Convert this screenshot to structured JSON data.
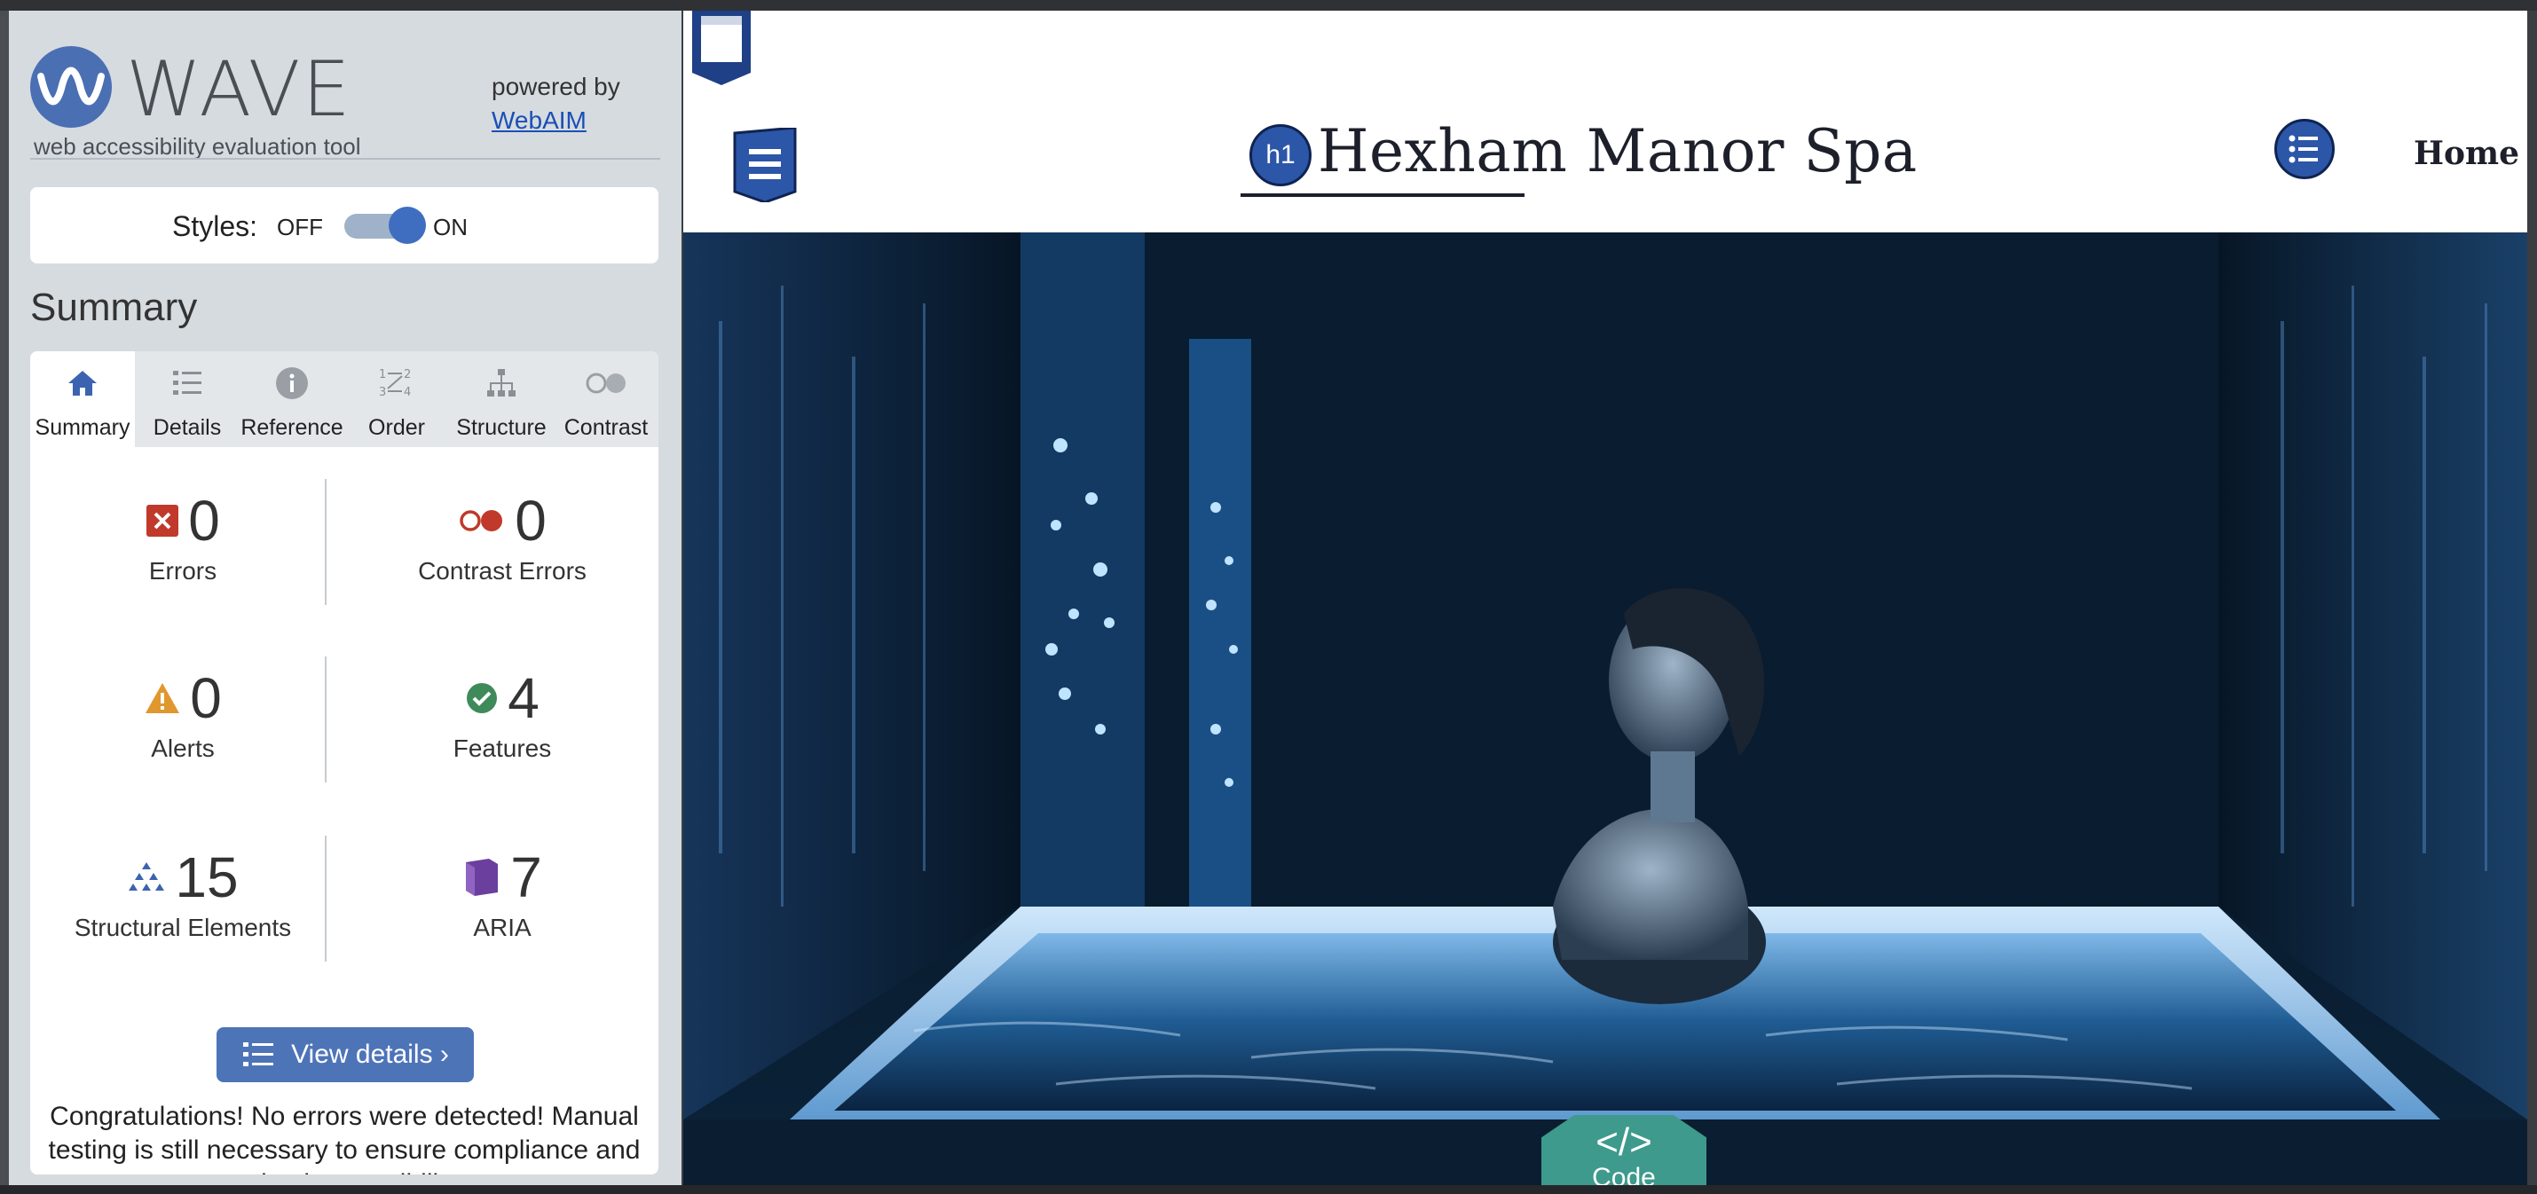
{
  "wave": {
    "brand": "WAVE",
    "tagline": "web accessibility evaluation tool",
    "powered_by": "powered by",
    "powered_link": "WebAIM",
    "styles_label": "Styles:",
    "off_label": "OFF",
    "on_label": "ON",
    "styles_on": true,
    "summary_title": "Summary",
    "tabs": [
      {
        "label": "Summary",
        "icon": "home-icon",
        "active": true
      },
      {
        "label": "Details",
        "icon": "list-icon",
        "active": false
      },
      {
        "label": "Reference",
        "icon": "info-icon",
        "active": false
      },
      {
        "label": "Order",
        "icon": "order-icon",
        "active": false
      },
      {
        "label": "Structure",
        "icon": "structure-icon",
        "active": false
      },
      {
        "label": "Contrast",
        "icon": "contrast-icon",
        "active": false
      }
    ],
    "stats": {
      "errors": {
        "count": "0",
        "label": "Errors",
        "icon": "error-icon",
        "color": "#c0392b"
      },
      "contrast": {
        "count": "0",
        "label": "Contrast Errors",
        "icon": "contrast-error-icon",
        "color": "#c0392b"
      },
      "alerts": {
        "count": "0",
        "label": "Alerts",
        "icon": "alert-icon",
        "color": "#e0972d"
      },
      "features": {
        "count": "4",
        "label": "Features",
        "icon": "feature-check-icon",
        "color": "#3f8a5a"
      },
      "structural": {
        "count": "15",
        "label": "Structural Elements",
        "icon": "structure-icon",
        "color": "#3c63b0"
      },
      "aria": {
        "count": "7",
        "label": "ARIA",
        "icon": "aria-icon",
        "color": "#6a3f9e"
      }
    },
    "view_details": "View details ›",
    "congrats": "Congratulations! No errors were detected! Manual testing is still necessary to ensure compliance and optimal accessibility."
  },
  "site": {
    "title": "Hexham Manor Spa",
    "nav_home": "Home",
    "h1_badge": "h1",
    "code_button_symbol": "</>",
    "code_button_label": "Code"
  },
  "colors": {
    "wave_blue": "#3c63b0",
    "sidebar_bg": "#d6dbe0",
    "code_teal": "#3e9a8c"
  }
}
